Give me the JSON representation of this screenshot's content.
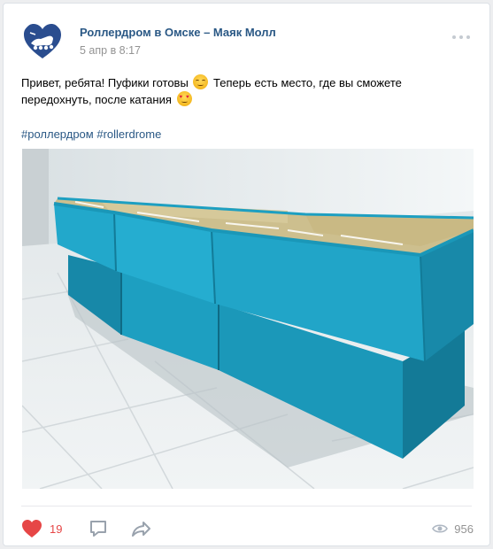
{
  "post": {
    "author": "Роллердром в Омске – Маяк Молл",
    "date": "5 апр в 8:17",
    "text_part1": "Привет, ребята! Пуфики готовы ",
    "emoji1": "relieved-face-emoji",
    "text_part2": " Теперь есть место, где вы сможете передохнуть, после катания ",
    "emoji2": "heart-eyes-emoji",
    "hashtags": [
      "#роллердром",
      "#rollerdrome"
    ]
  },
  "footer": {
    "likes": "19",
    "views": "956"
  },
  "icons": {
    "more": "more-dots-icon",
    "like": "heart-icon",
    "comment": "comment-icon",
    "share": "share-icon",
    "views": "eye-icon"
  },
  "colors": {
    "link": "#2a5885",
    "like_active": "#e64646",
    "muted": "#939393",
    "avatar_brand": "#2a4d8f",
    "pouf": "#1d9fc1"
  }
}
